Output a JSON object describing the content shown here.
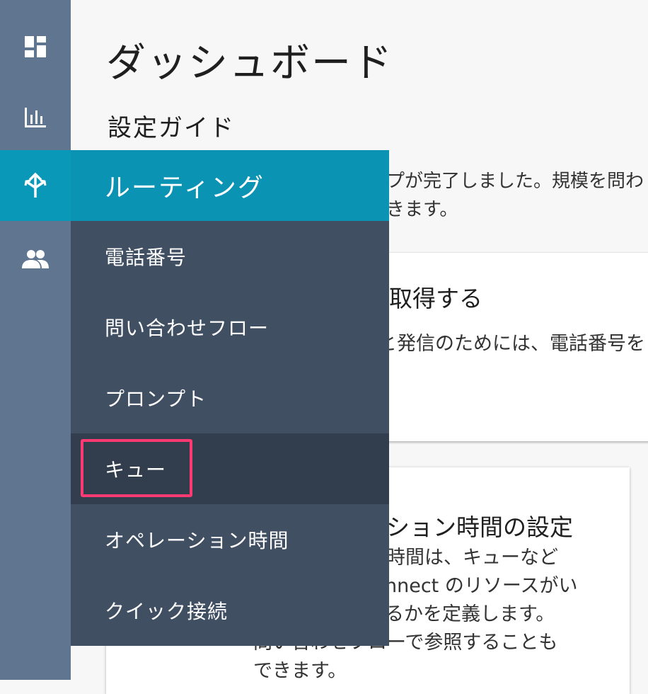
{
  "rail": {
    "items": [
      {
        "icon": "dashboard-icon"
      },
      {
        "icon": "metrics-icon"
      },
      {
        "icon": "routing-icon",
        "active": true
      },
      {
        "icon": "users-icon"
      }
    ]
  },
  "main": {
    "title": "ダッシュボード",
    "subtitle": "設定ガイド",
    "intro": [
      "プが完了しました。規模を問わ",
      "きます。"
    ],
    "card1": {
      "title": "取得する",
      "desc": "と発信のためには、電話番号を"
    },
    "card2": {
      "title": "ション時間の設定",
      "desc": [
        "時間は、キューなど",
        "nnect のリソースがい",
        "るかを定義します。",
        "問い合わせフローで参照することも",
        "できます。"
      ]
    }
  },
  "flyout": {
    "header": "ルーティング",
    "items": [
      {
        "label": "電話番号"
      },
      {
        "label": "問い合わせフロー"
      },
      {
        "label": "プロンプト"
      },
      {
        "label": "キュー",
        "highlighted": true
      },
      {
        "label": "オペレーション時間"
      },
      {
        "label": "クイック接続"
      }
    ]
  },
  "colors": {
    "rail_bg": "#5f7590",
    "rail_active": "#0a98b8",
    "flyout_header": "#0b93b4",
    "flyout_bg": "#414f63",
    "flyout_hover": "#323e4d",
    "highlight_border": "#ff3a72"
  }
}
